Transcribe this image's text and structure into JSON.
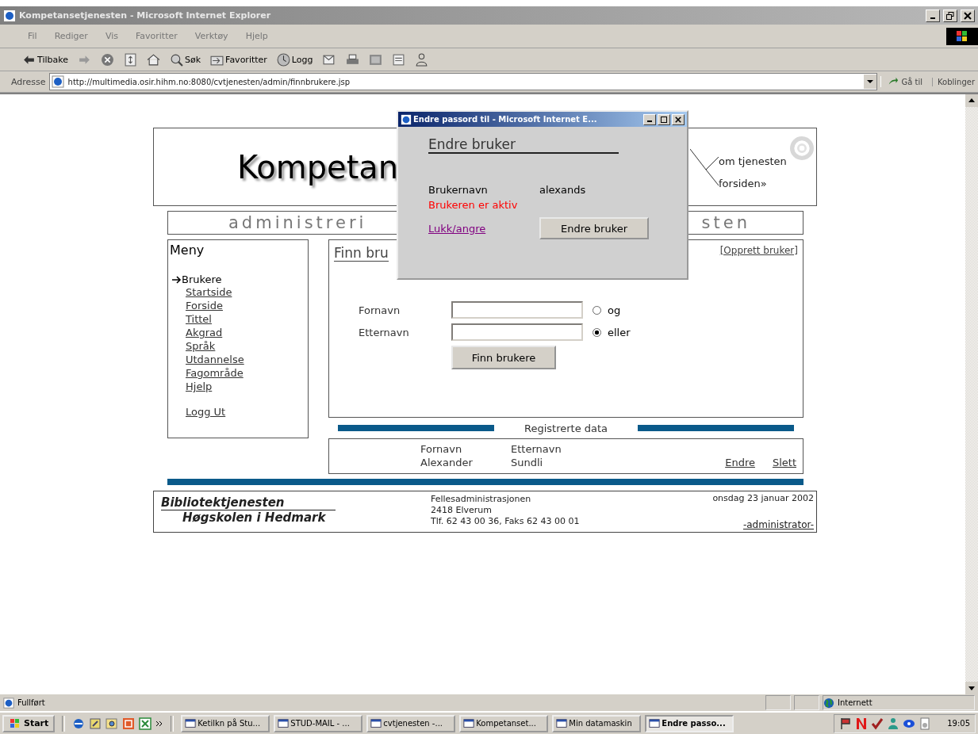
{
  "window": {
    "title": "Kompetansetjenesten - Microsoft Internet Explorer"
  },
  "menu_bar": [
    "Fil",
    "Rediger",
    "Vis",
    "Favoritter",
    "Verktøy",
    "Hjelp"
  ],
  "toolbar": [
    {
      "label": "Tilbake",
      "kind": "back"
    },
    {
      "kind": "forward"
    },
    {
      "kind": "stop"
    },
    {
      "kind": "refresh"
    },
    {
      "kind": "home"
    },
    {
      "label": "Søk",
      "kind": "search"
    },
    {
      "label": "Favoritter",
      "kind": "favorites"
    },
    {
      "label": "Logg",
      "kind": "history"
    },
    {
      "kind": "mail"
    },
    {
      "kind": "print"
    },
    {
      "kind": "edit"
    },
    {
      "kind": "discuss"
    },
    {
      "kind": "messenger"
    }
  ],
  "address_bar": {
    "label": "Adresse",
    "value": "http://multimedia.osir.hihm.no:8080/cvtjenesten/admin/finnbrukere.jsp",
    "go": "Gå til",
    "links": "Koblinger"
  },
  "page": {
    "header": {
      "title": "Kompetan",
      "links": [
        "om tjenesten",
        "forsiden»"
      ]
    },
    "subtitle": [
      "administreri",
      "sten"
    ],
    "menu": {
      "title": "Meny",
      "items": [
        {
          "label": "Brukere",
          "current": true
        },
        {
          "label": "Startside",
          "current": false
        },
        {
          "label": "Forside",
          "current": false
        },
        {
          "label": "Tittel",
          "current": false
        },
        {
          "label": "Akgrad",
          "current": false
        },
        {
          "label": "Språk",
          "current": false
        },
        {
          "label": "Utdannelse",
          "current": false
        },
        {
          "label": "Fagområde",
          "current": false
        },
        {
          "label": "Hjelp",
          "current": false
        }
      ],
      "logout": "Logg Ut"
    },
    "search": {
      "title": "Finn bru",
      "create_link": "[Opprett bruker]",
      "fields": [
        {
          "label": "Fornavn"
        },
        {
          "label": "Etternavn"
        }
      ],
      "radios": [
        {
          "label": "og",
          "selected": false
        },
        {
          "label": "eller",
          "selected": true
        }
      ],
      "button": "Finn brukere"
    },
    "results": {
      "caption": "Registrerte data",
      "columns": [
        "Fornavn",
        "Etternavn"
      ],
      "rows": [
        {
          "cells": [
            "Alexander",
            "Sundli"
          ],
          "actions": [
            "Endre",
            "Slett"
          ]
        }
      ]
    },
    "footer": {
      "org": [
        "Bibliotektjenesten",
        "Høgskolen i Hedmark"
      ],
      "address": [
        "Fellesadministrasjonen",
        "2418 Elverum",
        "Tlf. 62 43 00 36, Faks 62 43 00 01"
      ],
      "date": "onsdag 23 januar 2002",
      "role": "-administrator-"
    }
  },
  "popup": {
    "title": "Endre passord til - Microsoft Internet E...",
    "heading": "Endre bruker",
    "field_label": "Brukernavn",
    "field_value": "alexands",
    "status": "Brukeren er aktiv",
    "link": "Lukk/angre",
    "button": "Endre bruker"
  },
  "status_bar": {
    "text": "Fullført",
    "zone": "Internett"
  },
  "taskbar": {
    "start": "Start",
    "tasks": [
      {
        "label": "Ketilkn på Stu...",
        "selected": false
      },
      {
        "label": "STUD-MAIL - ...",
        "selected": false
      },
      {
        "label": "cvtjenesten -...",
        "selected": false
      },
      {
        "label": "Kompetanset...",
        "selected": false
      },
      {
        "label": "Min datamaskin",
        "selected": false
      },
      {
        "label": "Endre passo...",
        "selected": true
      }
    ],
    "clock": "19:05"
  }
}
